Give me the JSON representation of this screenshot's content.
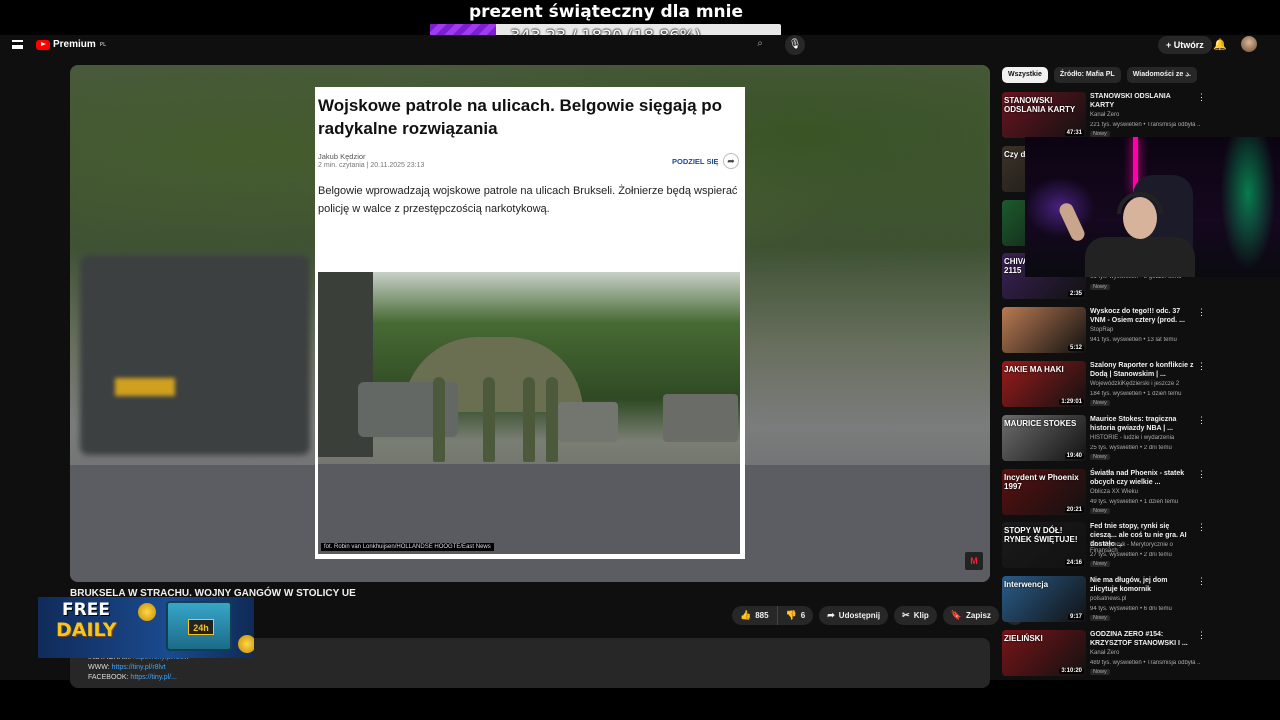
{
  "overlay": {
    "donation_title": "prezent świąteczny dla mnie",
    "goal_text": "343.23 / 1820 (18.86%)",
    "goal_progress": 0.1886
  },
  "masthead": {
    "logo_text": "Premium",
    "logo_region": "PL",
    "create_label": "Utwórz"
  },
  "article": {
    "title": "Wojskowe patrole na ulicach. Belgowie sięgają po radykalne rozwiązania",
    "author": "Jakub Kędzior",
    "meta": "2 min. czytania | 20.11.2025 23:13",
    "share_label": "PODZIEL SIĘ",
    "lead": "Belgowie wprowadzają wojskowe patrole na ulicach Brukseli. Żołnierze będą wspierać policję w walce z przestępczością narkotykową.",
    "photo_credit": "fot. Robin van Lonkhuijsen/HOLLANDSE HOOGTE/East News"
  },
  "video": {
    "watermark": "M",
    "title": "BRUKSELA W STRACHU. WOJNY GANGÓW W STOLICY UE",
    "likes": "885",
    "dislikes": "6",
    "share_label": "Udostępnij",
    "clip_label": "Klip",
    "save_label": "Zapisz",
    "desc_lines": [
      {
        "label": "INSTAGRAM:",
        "link": "https://tiny.pl/rb8w"
      },
      {
        "label": "WWW:",
        "link": "https://tiny.pl/r8lvt"
      },
      {
        "label": "FACEBOOK:",
        "link": "https://tiny.pl/..."
      }
    ]
  },
  "chips": [
    "Wszystkie",
    "Źródło: Mafia PL",
    "Wiadomości ze ..."
  ],
  "recommendations": [
    {
      "title": "STANOWSKI ODSLANIA KARTY",
      "channel": "Kanał Zero",
      "views": "221 tys. wyświetleń • Transmisja odbyła ...",
      "badge": "Nowy",
      "duration": "47:31",
      "thumb_text": "STANOWSKI ODSLANIA KARTY",
      "color": "#6a1420"
    },
    {
      "title": "",
      "channel": "",
      "views": "",
      "badge": "",
      "duration": "",
      "thumb_text": "Czy d DOM",
      "color": "#3b3328"
    },
    {
      "title": "",
      "channel": "",
      "views": "",
      "badge": "",
      "duration": "",
      "thumb_text": "",
      "color": "#1c5a2c"
    },
    {
      "title": "",
      "channel": "",
      "views": "61 tys. wyświetleń • 8 godzin temu",
      "badge": "Nowy",
      "duration": "2:35",
      "thumb_text": "CHIVAS & KUQE 2115",
      "color": "#3a2256"
    },
    {
      "title": "Wyskocz do tego!!! odc. 37 VNM - Osiem cztery (prod. ...",
      "channel": "StopRap",
      "views": "941 tys. wyświetleń • 13 lat temu",
      "badge": "",
      "duration": "5:12",
      "thumb_text": "",
      "color": "#b97a52"
    },
    {
      "title": "Szalony Raporter o konflikcie z Dodą | Stanowskim | ...",
      "channel": "WojewódzkiKędzierski i jeszcze 2",
      "views": "184 tys. wyświetleń • 1 dzień temu",
      "badge": "Nowy",
      "duration": "1:29:01",
      "thumb_text": "JAKIE MA HAKI",
      "color": "#9a1b1b"
    },
    {
      "title": "Maurice Stokes: tragiczna historia gwiazdy NBA | ...",
      "channel": "HISTORIE - ludzie i wydarzenia",
      "views": "25 tys. wyświetleń • 2 dni temu",
      "badge": "Nowy",
      "duration": "19:40",
      "thumb_text": "MAURICE STOKES",
      "color": "#6d6d6d"
    },
    {
      "title": "Światła nad Phoenix - statek obcych czy wielkie ...",
      "channel": "Oblicza XX Wieku",
      "views": "49 tys. wyświetleń • 1 dzień temu",
      "badge": "Nowy",
      "duration": "20:21",
      "thumb_text": "Incydent w Phoenix 1997",
      "color": "#5a1010"
    },
    {
      "title": "Fed tnie stopy, rynki się cieszą... ale coś tu nie gra. AI dostało ...",
      "channel": "Piotr Cymcyk - Merytorycznie o Finansach",
      "views": "27 tys. wyświetleń • 2 dni temu",
      "badge": "Nowy",
      "duration": "24:16",
      "thumb_text": "STOPY W DÓŁ! RYNEK ŚWIĘTUJE!",
      "color": "#1a1a1a"
    },
    {
      "title": "Nie ma długów, jej dom zlicytuje komornik",
      "channel": "polsatnews.pl",
      "views": "94 tys. wyświetleń • 6 dni temu",
      "badge": "Nowy",
      "duration": "9:17",
      "thumb_text": "Interwencja",
      "color": "#2a5c8a"
    },
    {
      "title": "GODZINA ZERO #154: KRZYSZTOF STANOWSKI I ...",
      "channel": "Kanał Zero",
      "views": "489 tys. wyświetleń • Transmisja odbyła ...",
      "badge": "Nowy",
      "duration": "3:10:20",
      "thumb_text": "ZIELIŃSKI",
      "color": "#7a1418"
    }
  ],
  "ad": {
    "free": "FREE",
    "daily": "DAILY",
    "box_label": "24h"
  }
}
